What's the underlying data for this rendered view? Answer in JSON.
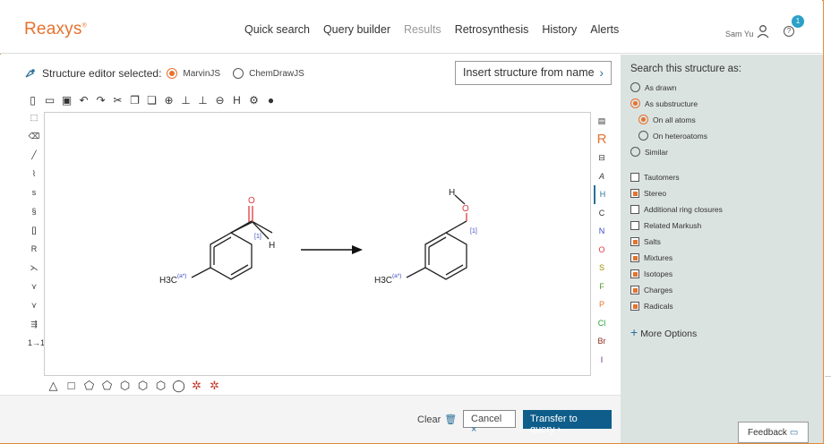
{
  "header": {
    "logo": "Reaxys",
    "logo_mark": "®",
    "nav": [
      "Quick search",
      "Query builder",
      "Results",
      "Retrosynthesis",
      "History",
      "Alerts"
    ],
    "user_name": "Sam Yu",
    "help_glyph": "?",
    "notification_count": "1"
  },
  "editor": {
    "selected_label": "Structure editor selected:",
    "options": [
      "MarvinJS",
      "ChemDrawJS"
    ],
    "selected_option": "MarvinJS",
    "insert_label": "Insert structure from name",
    "insert_chevron": "›",
    "right_toolbar": [
      "R",
      "A",
      "H",
      "C",
      "N",
      "O",
      "S",
      "F",
      "P",
      "Cl",
      "Br",
      "I"
    ],
    "left_toolbar_text": [
      "s",
      "[]",
      "R",
      "1→1"
    ],
    "molecule": {
      "reactant_group": "H3C",
      "reactant_label_sub": "3",
      "reactant_atom_o": "O",
      "reactant_atom_h": "H",
      "map1": "(a*)",
      "map2": "[1]",
      "product_group": "H3C",
      "product_atom_o": "O",
      "product_atom_h": "H",
      "map3": "(a*)",
      "map4": "[1]"
    }
  },
  "footer": {
    "clear": "Clear",
    "cancel": "Cancel",
    "cancel_icon": "×",
    "transfer": "Transfer to query",
    "transfer_icon": "›"
  },
  "side": {
    "title": "Search this structure as:",
    "search_modes": [
      {
        "label": "As drawn",
        "selected": false
      },
      {
        "label": "As substructure",
        "selected": true
      },
      {
        "label": "On all atoms",
        "selected": true
      },
      {
        "label": "On heteroatoms",
        "selected": false
      },
      {
        "label": "Similar",
        "selected": false
      }
    ],
    "checks": [
      {
        "label": "Tautomers",
        "checked": false
      },
      {
        "label": "Stereo",
        "checked": true
      },
      {
        "label": "Additional ring closures",
        "checked": false
      },
      {
        "label": "Related Markush",
        "checked": false
      },
      {
        "label": "Salts",
        "checked": true
      },
      {
        "label": "Mixtures",
        "checked": true
      },
      {
        "label": "Isotopes",
        "checked": true
      },
      {
        "label": "Charges",
        "checked": true
      },
      {
        "label": "Radicals",
        "checked": true
      }
    ],
    "more_options": "More Options",
    "more_icon": "+",
    "feedback": "Feedback"
  },
  "colors": {
    "brand": "#e6722e",
    "primary": "#0e5d8a",
    "side_bg": "#dbe3e1",
    "atom_o": "#e0393e",
    "map": "#3b49c2"
  }
}
